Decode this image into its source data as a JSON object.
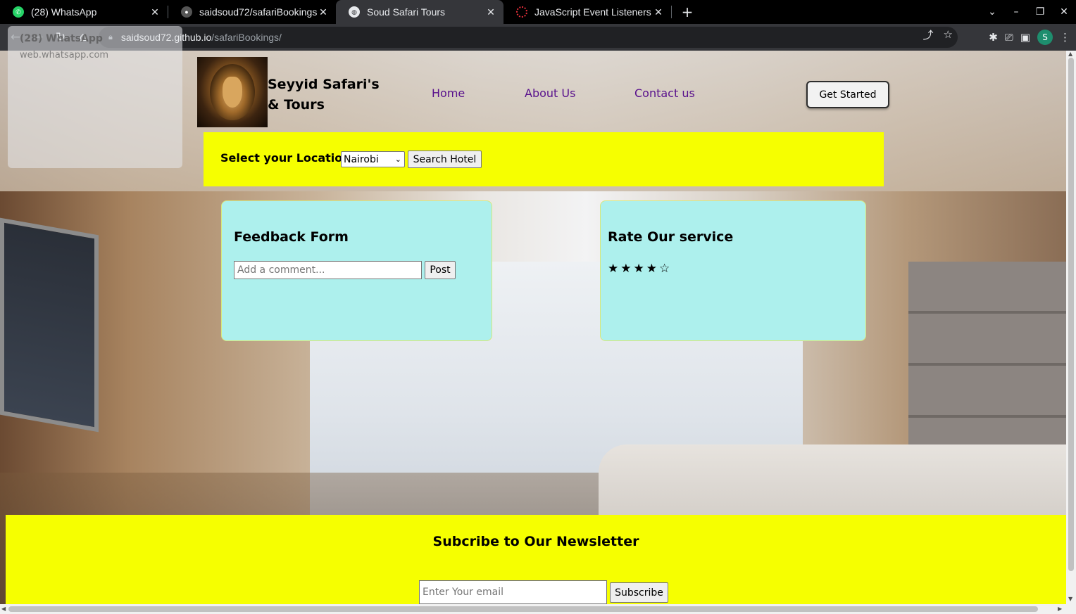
{
  "browser": {
    "tabs": [
      {
        "title": "(28) WhatsApp",
        "favicon": "whatsapp-icon",
        "favicon_color": "#25d366",
        "active": false
      },
      {
        "title": "saidsoud72/safariBookings",
        "favicon": "github-icon",
        "favicon_color": "#555555",
        "active": false
      },
      {
        "title": "Soud Safari Tours",
        "favicon": "globe-icon",
        "favicon_color": "#e8eaed",
        "active": true
      },
      {
        "title": "JavaScript Event Listeners",
        "favicon": "spinner-icon",
        "favicon_color": "#e8303b",
        "active": false
      }
    ],
    "url_domain": "saidsoud72.github.io",
    "url_path": "/safariBookings/",
    "profile_initial": "S",
    "hover_preview": {
      "title": "(28) WhatsApp",
      "subtitle": "web.whatsapp.com"
    }
  },
  "header": {
    "brand_name": "Seyyid Safari's & Tours",
    "nav": [
      "Home",
      "About Us",
      "Contact us"
    ],
    "cta": "Get Started",
    "nav_color": "#58108c"
  },
  "location": {
    "label": "Select your Location:",
    "selected": "Nairobi",
    "button": "Search Hotel",
    "bg_color": "#f6ff00"
  },
  "feedback": {
    "title": "Feedback Form",
    "placeholder": "Add a comment...",
    "button": "Post"
  },
  "rating": {
    "title": "Rate Our service",
    "stars_filled": 4,
    "stars_total": 5
  },
  "newsletter": {
    "title": "Subcribe to Our Newsletter",
    "placeholder": "Enter Your email",
    "button": "Subscribe"
  },
  "colors": {
    "card_bg": "#adf0ed",
    "yellow": "#f6ff00"
  }
}
